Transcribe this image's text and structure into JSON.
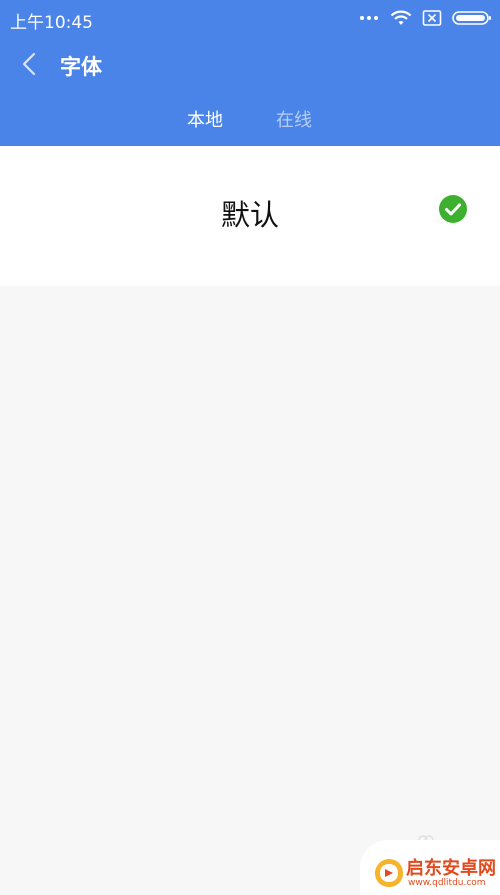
{
  "status_bar": {
    "time": "上午10:45"
  },
  "header": {
    "title": "字体",
    "back_icon": "chevron-left-icon",
    "background_color": "#4a84e8"
  },
  "tabs": [
    {
      "label": "本地",
      "active": true
    },
    {
      "label": "在线",
      "active": false
    }
  ],
  "font_list": {
    "items": [
      {
        "name": "默认",
        "selected": true,
        "check_color": "#3db12f"
      }
    ]
  },
  "watermark": {
    "title": "启东安卓网",
    "url": "www.qdlitdu.com"
  }
}
